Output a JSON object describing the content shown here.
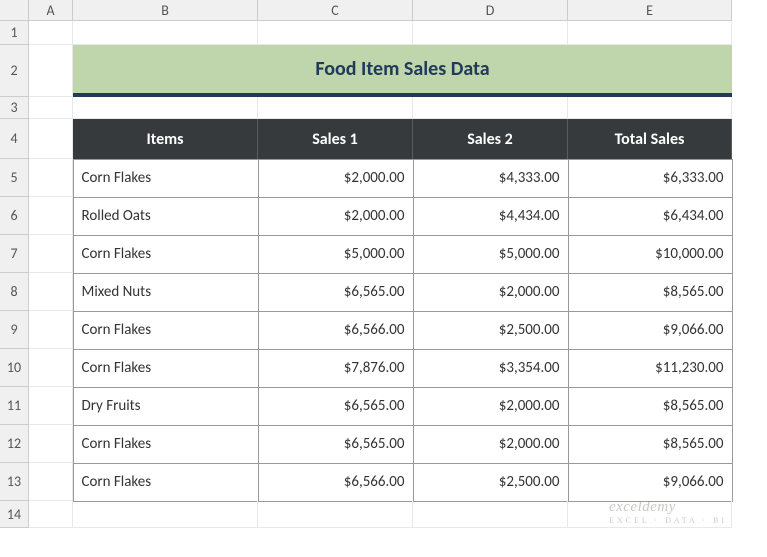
{
  "columns": [
    "A",
    "B",
    "C",
    "D",
    "E"
  ],
  "rows": [
    "1",
    "2",
    "3",
    "4",
    "5",
    "6",
    "7",
    "8",
    "9",
    "10",
    "11",
    "12",
    "13",
    "14"
  ],
  "title": "Food Item Sales Data",
  "headers": [
    "Items",
    "Sales 1",
    "Sales 2",
    "Total Sales"
  ],
  "data": [
    {
      "item": "Corn Flakes",
      "s1": "$2,000.00",
      "s2": "$4,333.00",
      "total": "$6,333.00"
    },
    {
      "item": "Rolled Oats",
      "s1": "$2,000.00",
      "s2": "$4,434.00",
      "total": "$6,434.00"
    },
    {
      "item": "Corn Flakes",
      "s1": "$5,000.00",
      "s2": "$5,000.00",
      "total": "$10,000.00"
    },
    {
      "item": "Mixed Nuts",
      "s1": "$6,565.00",
      "s2": "$2,000.00",
      "total": "$8,565.00"
    },
    {
      "item": "Corn Flakes",
      "s1": "$6,566.00",
      "s2": "$2,500.00",
      "total": "$9,066.00"
    },
    {
      "item": "Corn Flakes",
      "s1": "$7,876.00",
      "s2": "$3,354.00",
      "total": "$11,230.00"
    },
    {
      "item": "Dry Fruits",
      "s1": "$6,565.00",
      "s2": "$2,000.00",
      "total": "$8,565.00"
    },
    {
      "item": "Corn Flakes",
      "s1": "$6,565.00",
      "s2": "$2,000.00",
      "total": "$8,565.00"
    },
    {
      "item": "Corn Flakes",
      "s1": "$6,566.00",
      "s2": "$2,500.00",
      "total": "$9,066.00"
    }
  ],
  "watermark": {
    "main": "exceldemy",
    "sub": "EXCEL · DATA · BI"
  }
}
